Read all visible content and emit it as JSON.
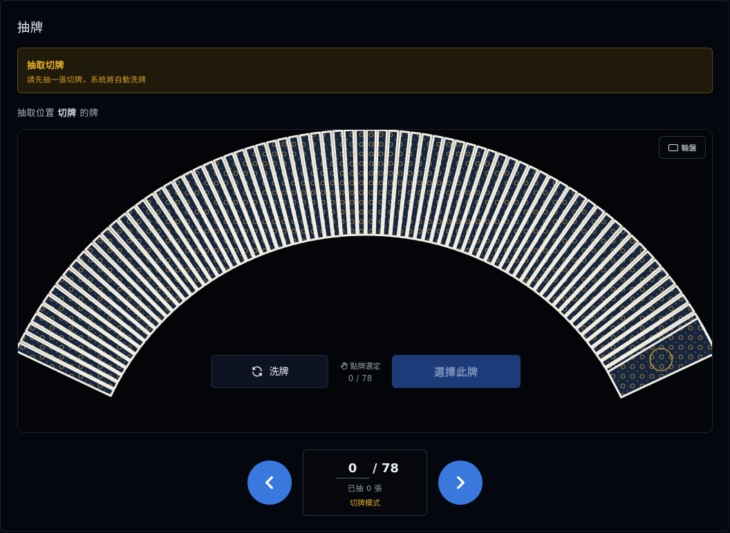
{
  "page": {
    "title": "抽牌"
  },
  "notice": {
    "title": "抽取切牌",
    "text": "請先抽一張切牌，系統將自動洗牌"
  },
  "subtitle": {
    "prefix": "抽取位置",
    "position": "切牌",
    "suffix": "的牌"
  },
  "deck": {
    "total_cards": 78,
    "wheel_label": "輪盤",
    "shuffle_label": "洗牌",
    "hint_label": "點牌選定",
    "selection": "0 / 78",
    "select_label": "選擇此牌",
    "colors": {
      "card_back": "#17263f",
      "card_edge": "#f1ede2",
      "gold": "#c99a3c"
    }
  },
  "counter": {
    "current": "0",
    "total": "/ 78",
    "drawn": "已抽 0 張",
    "mode": "切牌模式"
  }
}
